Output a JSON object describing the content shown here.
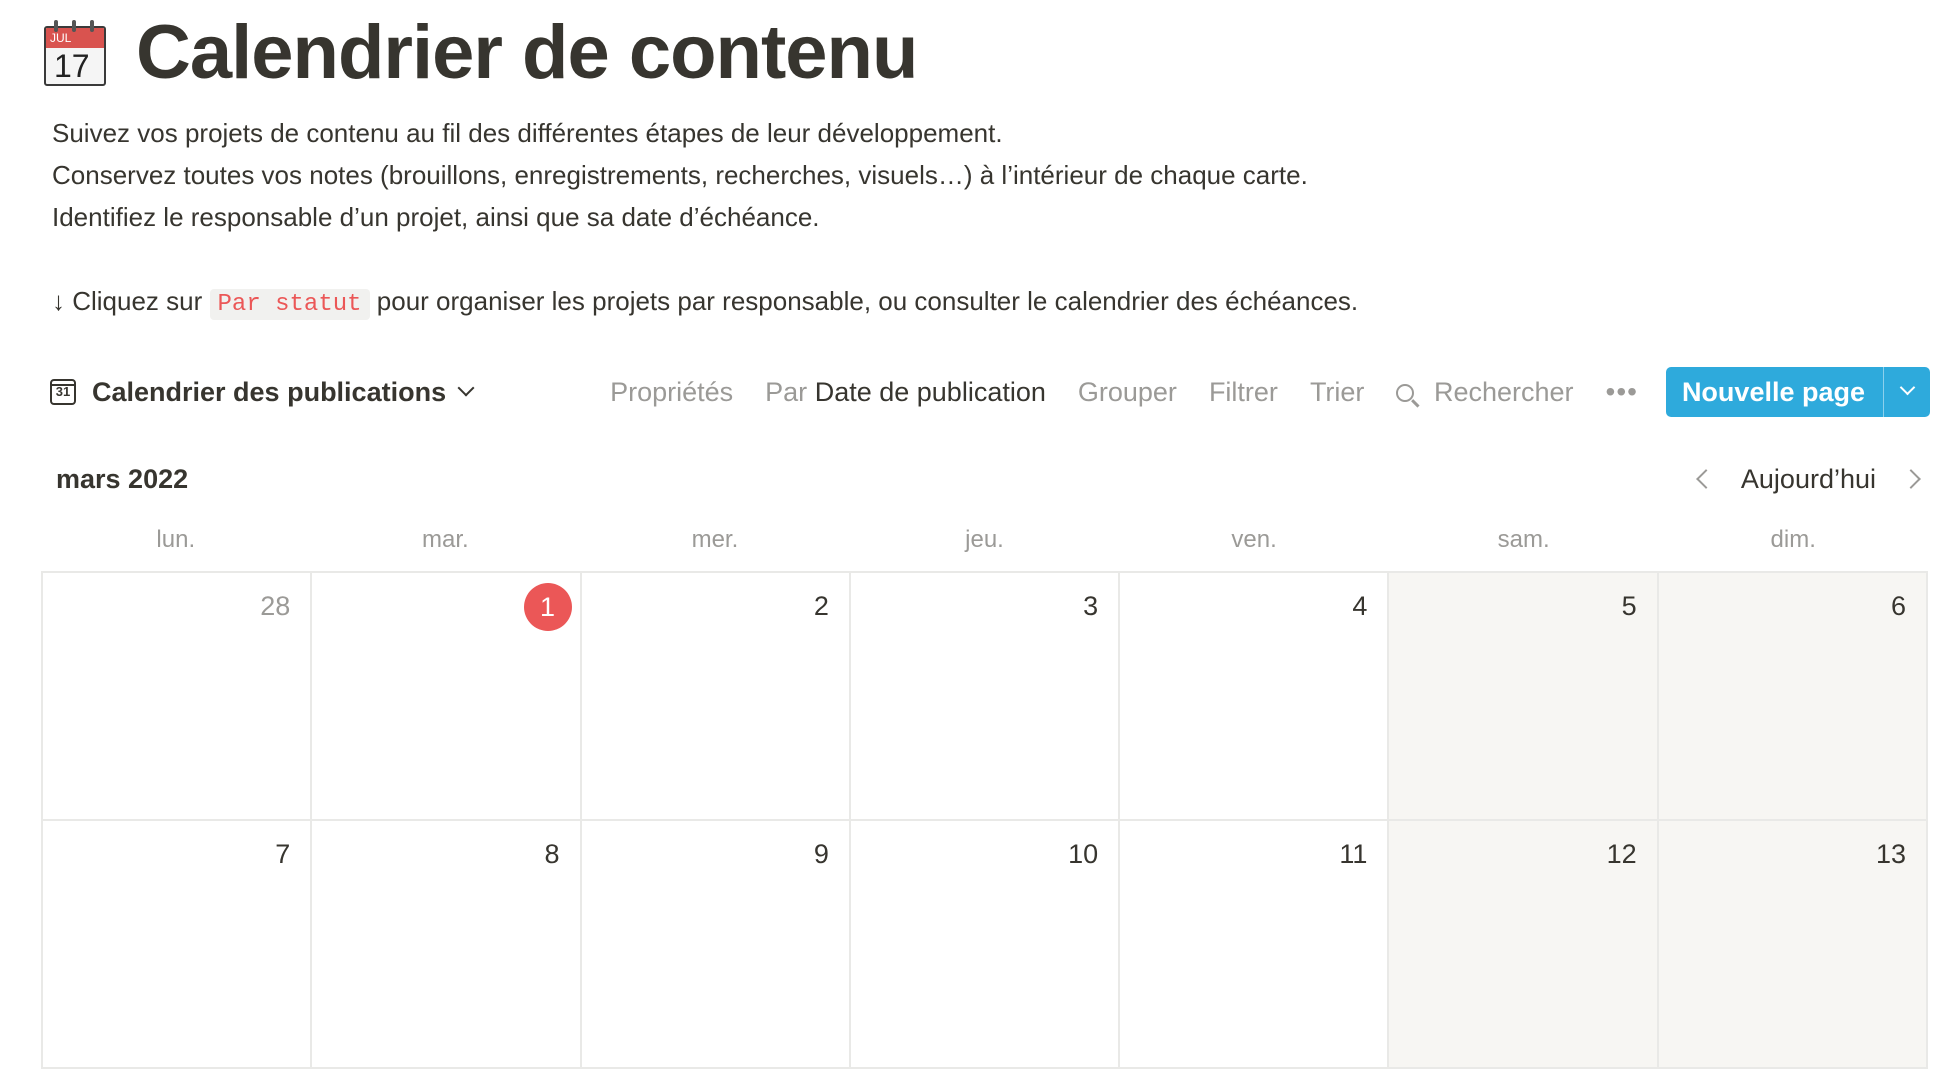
{
  "page": {
    "title": "Calendrier de contenu",
    "icon": "calendar-icon",
    "icon_month": "JUL",
    "icon_day": "17"
  },
  "description": {
    "line1": "Suivez vos projets de contenu au fil des différentes étapes de leur développement.",
    "line2": "Conservez toutes vos notes (brouillons, enregistrements, recherches, visuels…) à l’intérieur de chaque carte.",
    "line3": "Identifiez le responsable d’un projet, ainsi que sa date d’échéance.",
    "hint_prefix": "↓ Cliquez sur",
    "hint_code": "Par statut",
    "hint_suffix": "pour organiser les projets par responsable, ou consulter le calendrier des échéances."
  },
  "toolbar": {
    "view_icon_text": "31",
    "view_name": "Calendrier des publications",
    "properties": "Propriétés",
    "by_prefix": "Par",
    "by_value": "Date de publication",
    "group": "Grouper",
    "filter": "Filtrer",
    "sort": "Trier",
    "search": "Rechercher",
    "more": "•••",
    "new_page": "Nouvelle page"
  },
  "calendar": {
    "month": "mars 2022",
    "today_label": "Aujourd’hui",
    "weekdays": [
      "lun.",
      "mar.",
      "mer.",
      "jeu.",
      "ven.",
      "sam.",
      "dim."
    ],
    "days": [
      {
        "n": "28",
        "other": true
      },
      {
        "n": "1",
        "today": true
      },
      {
        "n": "2"
      },
      {
        "n": "3"
      },
      {
        "n": "4"
      },
      {
        "n": "5"
      },
      {
        "n": "6"
      },
      {
        "n": "7"
      },
      {
        "n": "8"
      },
      {
        "n": "9"
      },
      {
        "n": "10"
      },
      {
        "n": "11"
      },
      {
        "n": "12"
      },
      {
        "n": "13"
      }
    ]
  },
  "colors": {
    "accent": "#2eaadc",
    "today": "#eb5757",
    "code_text": "#eb5757",
    "weekend_bg": "#f7f6f3"
  }
}
